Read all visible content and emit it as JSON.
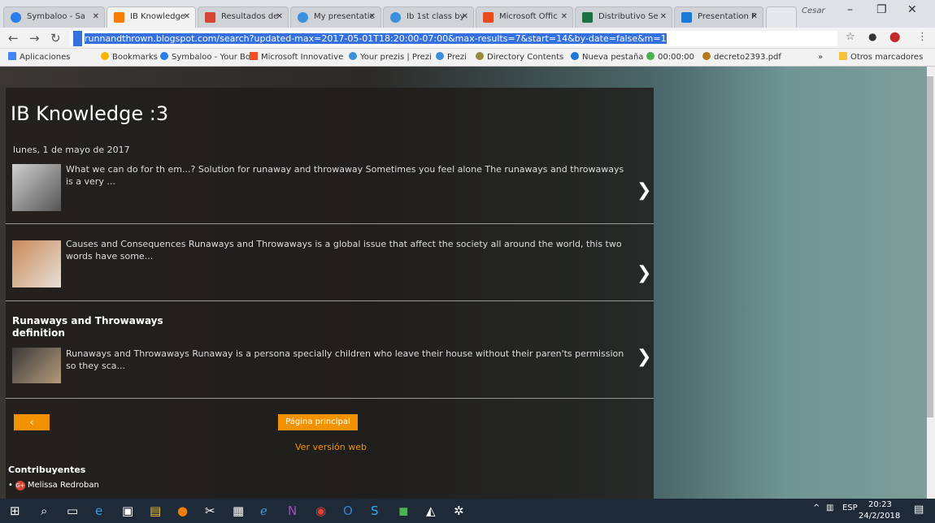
{
  "tabs": [
    {
      "label": "Symbaloo - Sa",
      "color": "#2b7de9"
    },
    {
      "label": "IB Knowledge",
      "color": "#f57d00"
    },
    {
      "label": "Resultados de",
      "color": "#d44638"
    },
    {
      "label": "My presentatic",
      "color": "#3b8fde"
    },
    {
      "label": "Ib 1st class by",
      "color": "#3b8fde"
    },
    {
      "label": "Microsoft Offic",
      "color": "#e74c1c"
    },
    {
      "label": "Distributivo Se",
      "color": "#1d7043"
    },
    {
      "label": "Presentation P",
      "color": "#1e78d7"
    }
  ],
  "user": "Cesar",
  "url": "runnandthrown.blogspot.com/search?updated-max=2017-05-01T18:20:00-07:00&max-results=7&start=14&by-date=false&m=1",
  "bookmarks": [
    "Aplicaciones",
    "Bookmarks",
    "Symbaloo - Your Boo",
    "Microsoft Innovative",
    "Your prezis | Prezi",
    "Prezi",
    "Directory Contents",
    "Nueva pestaña",
    "00:00:00",
    "decreto2393.pdf"
  ],
  "bookmarks_more": "»",
  "bookmarks_other": "Otros marcadores",
  "blog": {
    "title": "IB Knowledge :3",
    "date": "lunes, 1 de mayo de 2017",
    "posts": [
      {
        "text": "What we can do for th em...? Solution for runaway and throwaway Sometimes you feel alone The runaways and throwaways is a very ..."
      },
      {
        "text": "Causes and Consequences  Runaways and Throwaways is a global issue that affect the society all around the world, this two words have some..."
      },
      {
        "title": "Runaways and Throwaways definition",
        "text": "Runaways and Throwaways Runaway is a persona specially children who leave their house without their paren'ts permission so they sca..."
      }
    ],
    "prev": "‹",
    "home": "Página principal",
    "web_version": "Ver versión web",
    "contributors_title": "Contribuyentes",
    "contributor": "Melissa Redroban"
  },
  "taskbar": {
    "lang": "ESP",
    "time": "20:23",
    "date": "24/2/2018"
  }
}
